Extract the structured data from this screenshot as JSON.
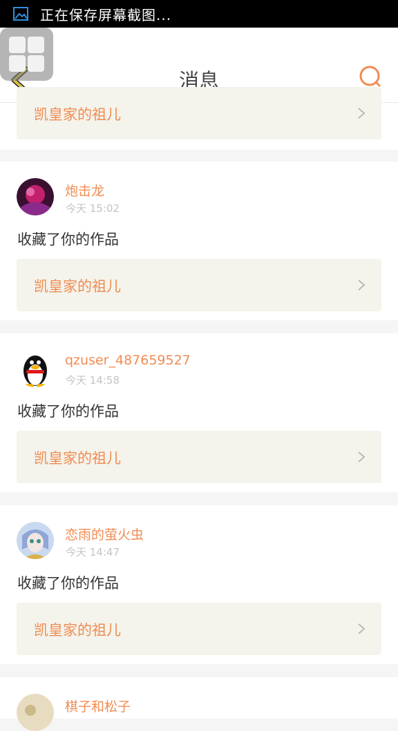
{
  "status_bar": {
    "text": "正在保存屏幕截图..."
  },
  "header": {
    "title": "消息"
  },
  "notifications": [
    {
      "user": "",
      "time": "",
      "action": "",
      "work": "凯皇家的祖儿"
    },
    {
      "user": "炮击龙",
      "time": "今天 15:02",
      "action": "收藏了你的作品",
      "work": "凯皇家的祖儿"
    },
    {
      "user": "qzuser_487659527",
      "time": "今天 14:58",
      "action": "收藏了你的作品",
      "work": "凯皇家的祖儿"
    },
    {
      "user": "恋雨的萤火虫",
      "time": "今天 14:47",
      "action": "收藏了你的作品",
      "work": "凯皇家的祖儿"
    },
    {
      "user": "棋子和松子",
      "time": "",
      "action": "",
      "work": ""
    }
  ],
  "colors": {
    "accent": "#f08c52",
    "work_box": "#f4f3ec",
    "time": "#c4c4c4"
  }
}
